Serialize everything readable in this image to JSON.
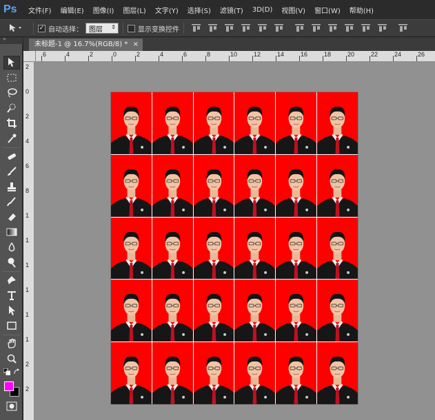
{
  "app": {
    "logo_text": "Ps"
  },
  "menu": [
    "文件(F)",
    "编辑(E)",
    "图像(I)",
    "图层(L)",
    "文字(Y)",
    "选择(S)",
    "滤镜(T)",
    "3D(D)",
    "视图(V)",
    "窗口(W)",
    "帮助(H)"
  ],
  "options": {
    "auto_select_checked": true,
    "auto_select_label": "自动选择：",
    "auto_select_value": "图层",
    "show_transform_checked": false,
    "show_transform_label": "显示变换控件"
  },
  "panel_collapse_label": "»",
  "document": {
    "tab_title": "未标题-1 @ 16.7%(RGB/8) *",
    "tab_close": "×",
    "rows": 5,
    "cols": 6
  },
  "rulers": {
    "top": [
      "6",
      "4",
      "2",
      "0",
      "2",
      "4",
      "6",
      "8",
      "10",
      "12",
      "14",
      "16",
      "18",
      "20",
      "22",
      "24",
      "26"
    ],
    "left": [
      "2",
      "0",
      "2",
      "4",
      "6",
      "8",
      "1",
      "1",
      "1",
      "1",
      "1",
      "1",
      "2",
      "2"
    ]
  },
  "colors": {
    "foreground": "#ff00ff",
    "background": "#000000",
    "photo_background": "#ff0000"
  },
  "tools": [
    "move-tool",
    "marquee-tool",
    "lasso-tool",
    "quick-selection-tool",
    "crop-tool",
    "eyedropper-tool",
    "healing-brush-tool",
    "brush-tool",
    "clone-stamp-tool",
    "history-brush-tool",
    "eraser-tool",
    "gradient-tool",
    "blur-tool",
    "dodge-tool",
    "pen-tool",
    "type-tool",
    "path-selection-tool",
    "shape-tool",
    "hand-tool",
    "zoom-tool"
  ]
}
